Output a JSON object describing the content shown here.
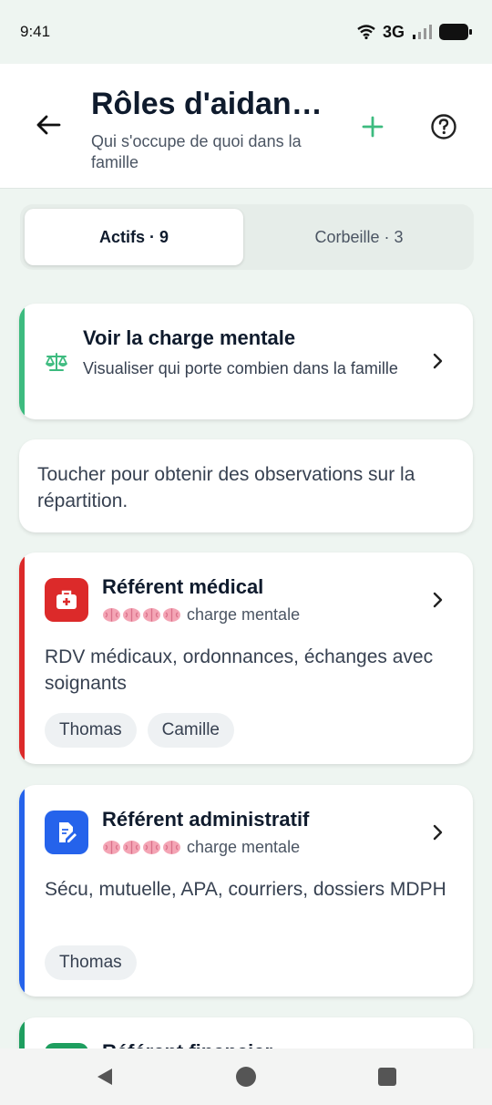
{
  "status_bar": {
    "time": "9:41",
    "network": "3G"
  },
  "header": {
    "title": "Rôles d'aidan…",
    "subtitle": "Qui s'occupe de quoi dans la famille",
    "back_icon": "arrow-left-icon",
    "add_icon": "plus-icon",
    "help_icon": "help-circle-icon"
  },
  "tabs": [
    {
      "label": "Actifs · 9",
      "active": true
    },
    {
      "label": "Corbeille · 3",
      "active": false
    }
  ],
  "charge_card": {
    "title": "Voir la charge mentale",
    "description": "Visualiser qui porte combien dans la famille",
    "icon": "scale-icon",
    "accent": "#3dbb7f"
  },
  "insight": {
    "text": "Toucher pour obtenir des observations sur la répartition."
  },
  "roles": [
    {
      "title": "Référent médical",
      "load_label": "charge mentale",
      "load_level": 4,
      "description": "RDV médicaux, ordonnances, échanges avec soignants",
      "members": [
        "Thomas",
        "Camille"
      ],
      "accent": "#dc2a2a",
      "icon": "medical-kit-icon"
    },
    {
      "title": "Référent administratif",
      "load_label": "charge mentale",
      "load_level": 4,
      "description": "Sécu, mutuelle, APA, courriers, dossiers MDPH",
      "members": [
        "Thomas"
      ],
      "accent": "#2563eb",
      "icon": "document-edit-icon"
    },
    {
      "title": "Référent financier",
      "accent": "#1e9e5f",
      "icon": "wallet-icon"
    }
  ],
  "colors": {
    "brand_green": "#3dbb7f",
    "background": "#eef5f1"
  }
}
